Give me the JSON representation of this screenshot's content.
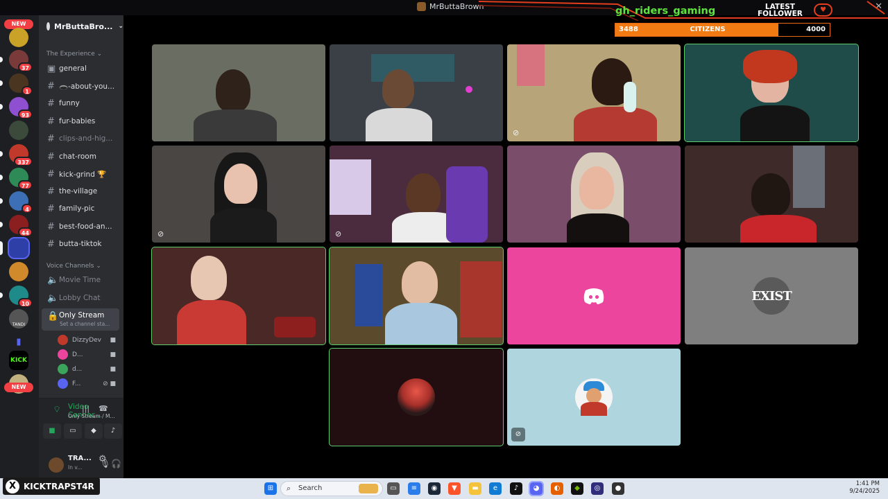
{
  "window": {
    "title": "MrButtaBrown",
    "controls": "✕"
  },
  "server": {
    "name": "MrButtaBro..."
  },
  "categories": {
    "text": "The Experience",
    "voice": "Voice Channels"
  },
  "text_channels": [
    {
      "name": "general"
    },
    {
      "name": "🕳️-about-you..."
    },
    {
      "name": "funny"
    },
    {
      "name": "fur-babies"
    },
    {
      "name": "clips-and-hig..."
    },
    {
      "name": "chat-room"
    },
    {
      "name": "kick-grind 🏆"
    },
    {
      "name": "the-village"
    },
    {
      "name": "family-pic"
    },
    {
      "name": "best-food-an..."
    },
    {
      "name": "butta-tiktok"
    }
  ],
  "voice_channels": [
    {
      "name": "Movie Time"
    },
    {
      "name": "Lobby Chat"
    },
    {
      "name": "Only Stream",
      "status": "Set a channel sta..."
    }
  ],
  "voice_users": [
    {
      "name": "DizzyDev",
      "color": "#c0392b"
    },
    {
      "name": "D...",
      "color": "#eb459e"
    },
    {
      "name": "d...",
      "color": "#3ba55c"
    },
    {
      "name": "F...",
      "color": "#5865f2"
    }
  ],
  "rail": {
    "new_label": "NEW",
    "badges": [
      "37",
      "1",
      "93",
      "337",
      "77",
      "4",
      "44",
      "10"
    ],
    "kick_label": "KICK",
    "tandi_label": "TANDI"
  },
  "voice_panel": {
    "status": "Video Connec...",
    "location": "Only Stream / M..."
  },
  "user": {
    "name": "TRA...",
    "status": "In v..."
  },
  "overlay": {
    "follower_name": "gh_riders_gaming",
    "latest_follower": "LATEST\nFOLLOWER",
    "goal": {
      "current": 3488,
      "target": 4000,
      "label": "CITIZENS",
      "current_label": "3488",
      "target_label": "4000"
    },
    "colors": {
      "follower": "#5fe43f",
      "accent": "#e53e1e",
      "bar": "#f27a12"
    }
  },
  "tiles": [
    {
      "id": "tile-1",
      "kind": "video",
      "bg": "#6a6d62"
    },
    {
      "id": "tile-2",
      "kind": "video",
      "bg": "#3b3f46"
    },
    {
      "id": "tile-3",
      "kind": "video",
      "bg": "#b7a478",
      "muted": true
    },
    {
      "id": "tile-4",
      "kind": "video",
      "bg": "#1f4c48",
      "speaking": true
    },
    {
      "id": "tile-5",
      "kind": "video",
      "bg": "#4a4644",
      "muted": true
    },
    {
      "id": "tile-6",
      "kind": "video",
      "bg": "#4b2b3e",
      "muted": true
    },
    {
      "id": "tile-7",
      "kind": "video",
      "bg": "#7a4e6a"
    },
    {
      "id": "tile-8",
      "kind": "video",
      "bg": "#3f2a2a"
    },
    {
      "id": "tile-9",
      "kind": "video",
      "bg": "#4a2826",
      "speaking": true
    },
    {
      "id": "tile-10",
      "kind": "video",
      "bg": "#5b4a2c",
      "speaking": true
    },
    {
      "id": "tile-11",
      "kind": "discord",
      "bg": "#eb459e"
    },
    {
      "id": "tile-12",
      "kind": "logo",
      "bg": "#7f7f7f",
      "logo_text": "EXIST"
    },
    {
      "id": "tile-13",
      "kind": "avatar",
      "bg": "#220e10",
      "speaking": true
    },
    {
      "id": "tile-14",
      "kind": "avatar",
      "bg": "#afd5de",
      "muted": true
    }
  ],
  "taskbar": {
    "search_placeholder": "Search",
    "time": "1:41 PM",
    "date": "9/24/2025"
  },
  "watermark": {
    "handle": "KICKTRAPST4R"
  }
}
